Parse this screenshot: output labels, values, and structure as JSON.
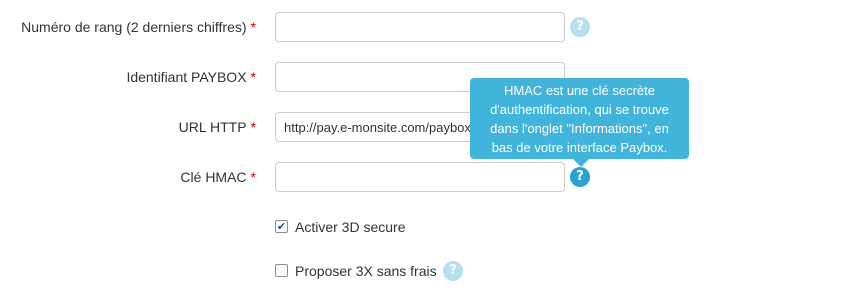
{
  "form": {
    "required_mark": "*",
    "help_glyph": "?",
    "fields": [
      {
        "label": "Numéro de rang (2 derniers chiffres)",
        "value": "",
        "help_icon": "question-circle-icon"
      },
      {
        "label": "Identifiant PAYBOX",
        "value": ""
      },
      {
        "label": "URL HTTP",
        "value": "http://pay.e-monsite.com/paybox"
      },
      {
        "label": "Clé HMAC",
        "value": "",
        "help_icon": "question-circle-icon"
      }
    ],
    "checkboxes": [
      {
        "label": "Activer 3D secure",
        "checked": true
      },
      {
        "label": "Proposer 3X sans frais",
        "checked": false,
        "help_icon": "question-circle-icon"
      }
    ],
    "check_glyph": "✔"
  },
  "tooltip": {
    "text": "HMAC est une clé secrète d'authentification, qui se trouve dans l'onglet \"Informations\", en bas de votre interface Paybox."
  },
  "colors": {
    "required": "#cc0000",
    "help_idle": "#b6dff0",
    "help_active": "#2aa3d3",
    "tooltip_bg": "#40b4db"
  }
}
